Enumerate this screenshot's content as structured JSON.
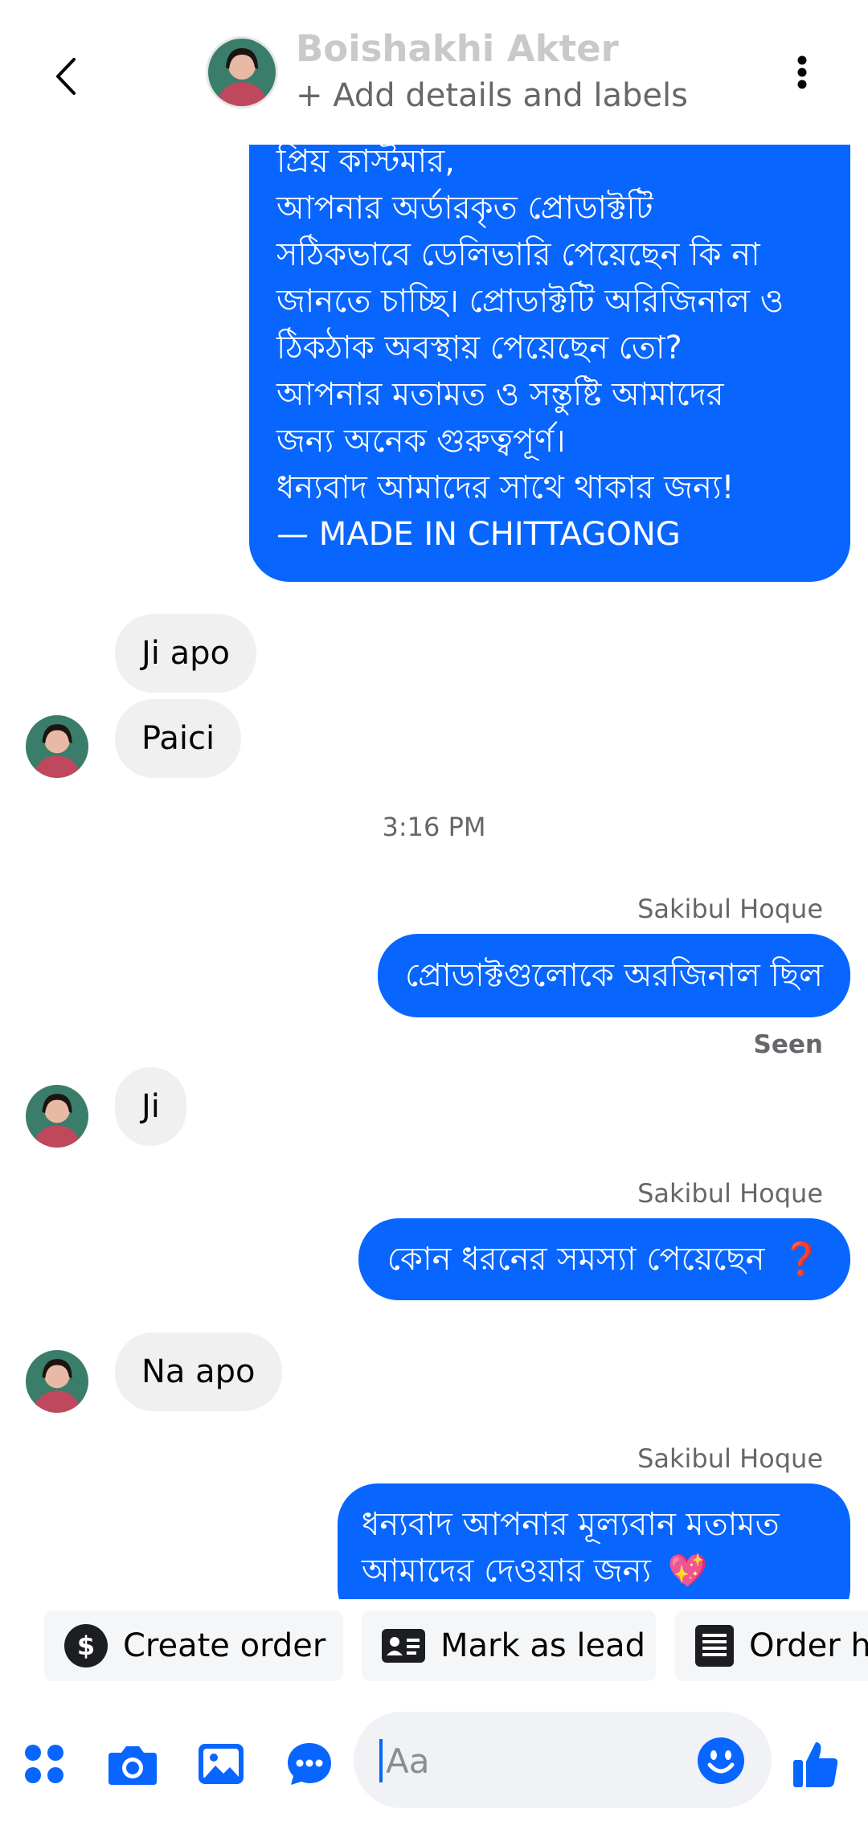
{
  "header": {
    "contact_name": "Boishakhi Akter",
    "subtitle": "+ Add details and labels"
  },
  "messages": {
    "m1_lines": [
      "প্রিয় কাস্টমার,",
      "আপনার অর্ডারকৃত প্রোডাক্টটি",
      "সঠিকভাবে ডেলিভারি পেয়েছেন কি না",
      "জানতে চাচ্ছি। প্রোডাক্টটি অরিজিনাল ও",
      "ঠিকঠাক অবস্থায় পেয়েছেন তো?",
      "আপনার মতামত ও সন্তুষ্টি আমাদের",
      "জন্য অনেক গুরুত্বপূর্ণ।",
      "ধন্যবাদ আমাদের সাথে থাকার জন্য!",
      "— MADE IN CHITTAGONG"
    ],
    "m2": "Ji apo",
    "m3": "Paici",
    "time": "3:16 PM",
    "sender_1": "Sakibul Hoque",
    "m4": "প্রোডাক্টগুলোকে অরজিনাল ছিল",
    "seen": "Seen",
    "m5": "Ji",
    "sender_2": "Sakibul Hoque",
    "m6": "কোন ধরনের সমস্যা পেয়েছেন",
    "m6_emoji": "❓",
    "m7": "Na apo",
    "sender_3": "Sakibul Hoque",
    "m8_line1": "ধন্যবাদ আপনার মূল্যবান মতামত",
    "m8_line2": "আমাদের দেওয়ার জন্য",
    "m8_emoji": "💖"
  },
  "quick_actions": {
    "create_order": "Create order",
    "mark_as_lead": "Mark as lead",
    "order_history": "Order h"
  },
  "composer": {
    "placeholder": "Aa"
  },
  "colors": {
    "accent": "#0866ff",
    "incoming_bubble": "#f0f0f0",
    "secondary_text": "#65676b"
  },
  "icons": {
    "back": "chevron-left-icon",
    "more": "more-vertical-icon",
    "apps": "apps-grid-icon",
    "camera": "camera-icon",
    "gallery": "gallery-icon",
    "chat": "chat-bubble-icon",
    "emoji": "smiley-icon",
    "like": "thumbs-up-icon",
    "dollar": "dollar-icon",
    "lead": "id-card-icon",
    "order": "receipt-icon"
  }
}
